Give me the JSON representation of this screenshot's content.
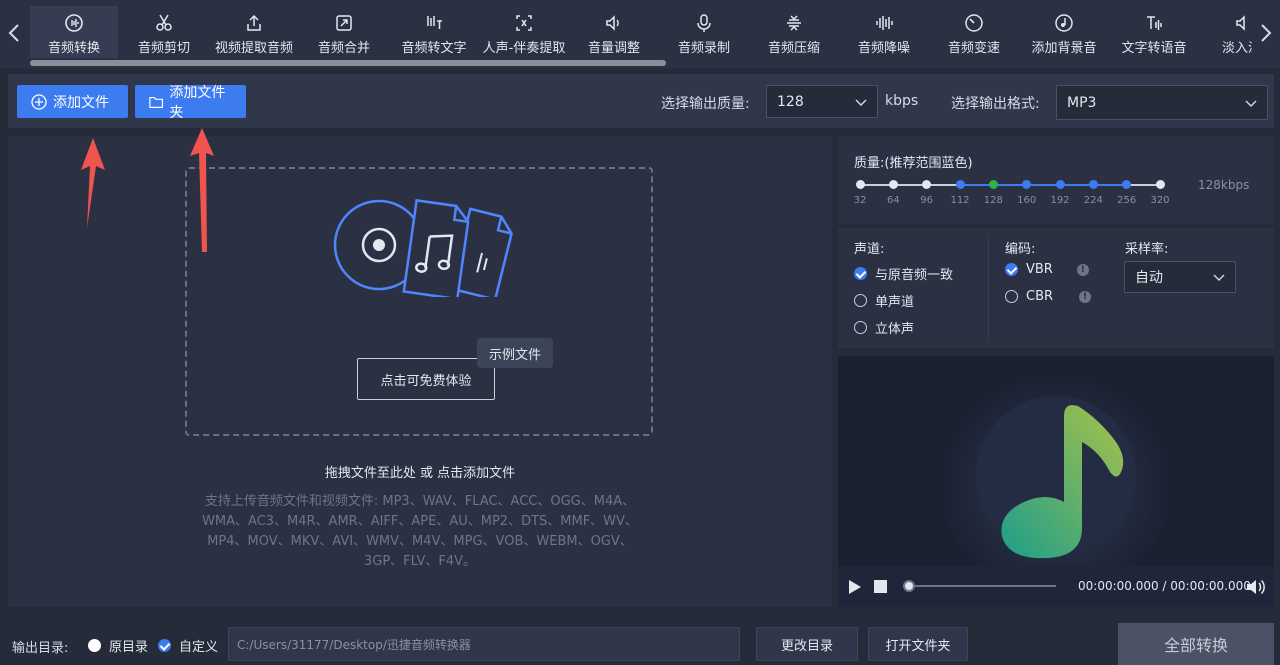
{
  "tabs": [
    {
      "label": "音频转换",
      "icon": "audio-convert-icon",
      "active": true
    },
    {
      "label": "音频剪切",
      "icon": "scissors-icon"
    },
    {
      "label": "视频提取音频",
      "icon": "upload-icon"
    },
    {
      "label": "音频合并",
      "icon": "merge-icon"
    },
    {
      "label": "音频转文字",
      "icon": "speech-to-text-icon"
    },
    {
      "label": "人声-伴奏提取",
      "icon": "vocal-extract-icon"
    },
    {
      "label": "音量调整",
      "icon": "volume-icon"
    },
    {
      "label": "音频录制",
      "icon": "microphone-icon"
    },
    {
      "label": "音频压缩",
      "icon": "compress-icon"
    },
    {
      "label": "音频降噪",
      "icon": "denoise-icon"
    },
    {
      "label": "音频变速",
      "icon": "speed-icon"
    },
    {
      "label": "添加背景音",
      "icon": "music-disc-icon"
    },
    {
      "label": "文字转语音",
      "icon": "text-to-speech-icon"
    },
    {
      "label": "淡入淡",
      "icon": "fade-icon"
    }
  ],
  "toolbar": {
    "add_file": "添加文件",
    "add_folder": "添加文件夹",
    "quality_label": "选择输出质量:",
    "quality_value": "128",
    "quality_unit": "kbps",
    "format_label": "选择输出格式:",
    "format_value": "MP3"
  },
  "dropzone": {
    "trial_button": "点击可免费体验",
    "sample_badge": "示例文件",
    "drag_hint": "拖拽文件至此处 或 点击添加文件",
    "formats_text": "支持上传音频文件和视频文件: MP3、WAV、FLAC、ACC、OGG、M4A、WMA、AC3、M4R、AMR、AIFF、APE、AU、MP2、DTS、MMF、WV、MP4、MOV、MKV、AVI、WMV、M4V、MPG、VOB、WEBM、OGV、3GP、FLV、F4V。"
  },
  "quality": {
    "title": "质量:(推荐范围蓝色)",
    "current": "128kbps",
    "selected": "128",
    "ticks": [
      "32",
      "64",
      "96",
      "112",
      "128",
      "160",
      "192",
      "224",
      "256",
      "320"
    ]
  },
  "options": {
    "channel_title": "声道:",
    "channel_options": [
      "与原音频一致",
      "单声道",
      "立体声"
    ],
    "channel_selected": "与原音频一致",
    "encoding_title": "编码:",
    "encoding_options": [
      "VBR",
      "CBR"
    ],
    "encoding_selected": "VBR",
    "info_glyph": "!",
    "samplerate_title": "采样率:",
    "samplerate_value": "自动"
  },
  "player": {
    "time": "00:00:00.000 / 00:00:00.000",
    "progress": 0
  },
  "bottom": {
    "output_label": "输出目录:",
    "original_dir": "原目录",
    "custom_dir": "自定义",
    "path": "C:/Users/31177/Desktop/迅捷音频转换器",
    "change_dir": "更改目录",
    "open_folder": "打开文件夹",
    "convert_all": "全部转换"
  },
  "colors": {
    "accent": "#3d7bf0",
    "annotation_arrow": "#f0544f",
    "selected_tick": "#2bb24c"
  }
}
